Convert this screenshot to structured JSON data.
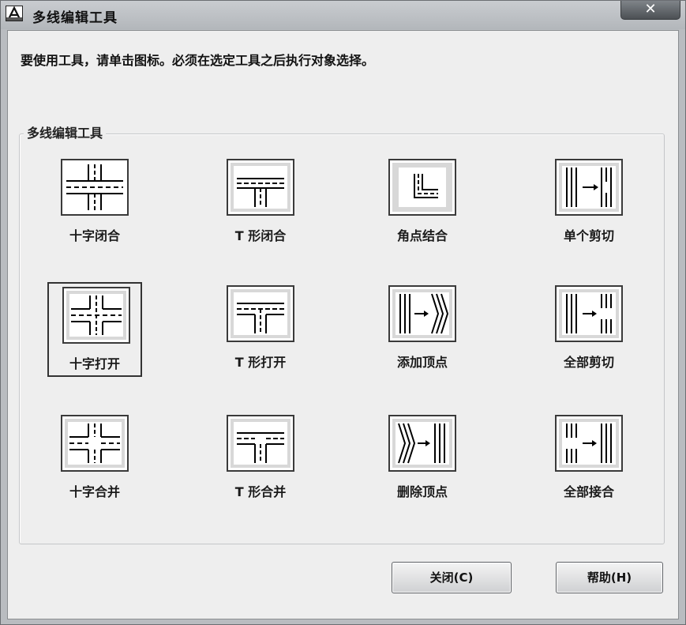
{
  "window": {
    "title": "多线编辑工具",
    "close_label": "✕"
  },
  "instruction": "要使用工具，请单击图标。必须在选定工具之后执行对象选择。",
  "group": {
    "title": "多线编辑工具",
    "tools": [
      {
        "label": "十字闭合",
        "icon": "closed-cross-icon",
        "selected": false
      },
      {
        "label": "T 形闭合",
        "icon": "closed-tee-icon",
        "selected": false
      },
      {
        "label": "角点结合",
        "icon": "corner-joint-icon",
        "selected": false
      },
      {
        "label": "单个剪切",
        "icon": "cut-single-icon",
        "selected": false
      },
      {
        "label": "十字打开",
        "icon": "open-cross-icon",
        "selected": true
      },
      {
        "label": "T 形打开",
        "icon": "open-tee-icon",
        "selected": false
      },
      {
        "label": "添加顶点",
        "icon": "add-vertex-icon",
        "selected": false
      },
      {
        "label": "全部剪切",
        "icon": "cut-all-icon",
        "selected": false
      },
      {
        "label": "十字合并",
        "icon": "merged-cross-icon",
        "selected": false
      },
      {
        "label": "T 形合并",
        "icon": "merged-tee-icon",
        "selected": false
      },
      {
        "label": "删除顶点",
        "icon": "delete-vertex-icon",
        "selected": false
      },
      {
        "label": "全部接合",
        "icon": "weld-all-icon",
        "selected": false
      }
    ]
  },
  "buttons": {
    "close": "关闭(C)",
    "help": "帮助(H)"
  }
}
